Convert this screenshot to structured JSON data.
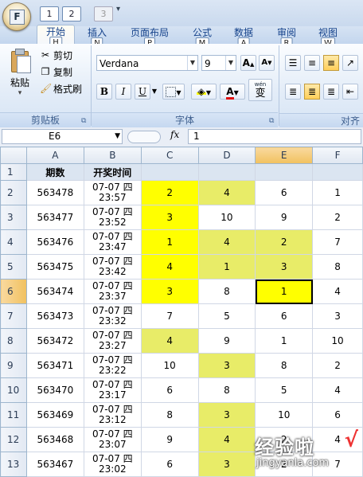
{
  "quick_access": {
    "office_key": "F",
    "keytips": [
      "1",
      "2",
      "3"
    ]
  },
  "tabs": [
    {
      "label": "开始",
      "keytip": "H",
      "active": true
    },
    {
      "label": "插入",
      "keytip": "N",
      "active": false
    },
    {
      "label": "页面布局",
      "keytip": "P",
      "active": false
    },
    {
      "label": "公式",
      "keytip": "M",
      "active": false
    },
    {
      "label": "数据",
      "keytip": "A",
      "active": false
    },
    {
      "label": "审阅",
      "keytip": "R",
      "active": false
    },
    {
      "label": "视图",
      "keytip": "W",
      "active": false
    }
  ],
  "ribbon": {
    "clipboard": {
      "paste_label": "粘贴",
      "cut_label": "剪切",
      "copy_label": "复制",
      "format_painter_label": "格式刷",
      "group_label": "剪贴板"
    },
    "font": {
      "font_name": "Verdana",
      "font_size": "9",
      "grow_label": "A",
      "shrink_label": "A",
      "bold_label": "B",
      "italic_label": "I",
      "underline_label": "U",
      "font_color_label": "A",
      "phonetic_label": "变",
      "phonetic_top": "wén",
      "group_label": "字体"
    },
    "alignment": {
      "group_label": "对齐"
    }
  },
  "formula_bar": {
    "name_box": "E6",
    "fx_label": "fx",
    "value": "1"
  },
  "sheet": {
    "columns": [
      "A",
      "B",
      "C",
      "D",
      "E",
      "F"
    ],
    "row_numbers": [
      "1",
      "2",
      "3",
      "4",
      "5",
      "6",
      "7",
      "8",
      "9",
      "10",
      "11",
      "12",
      "13"
    ],
    "header": {
      "period": "期数",
      "time": "开奖时间"
    },
    "rows": [
      {
        "period": "563478",
        "date": "07-07 四",
        "time": "23:57",
        "c": "2",
        "d": "4",
        "e": "6",
        "f": "1"
      },
      {
        "period": "563477",
        "date": "07-07 四",
        "time": "23:52",
        "c": "3",
        "d": "10",
        "e": "9",
        "f": "2"
      },
      {
        "period": "563476",
        "date": "07-07 四",
        "time": "23:47",
        "c": "1",
        "d": "4",
        "e": "2",
        "f": "7"
      },
      {
        "period": "563475",
        "date": "07-07 四",
        "time": "23:42",
        "c": "4",
        "d": "1",
        "e": "3",
        "f": "8"
      },
      {
        "period": "563474",
        "date": "07-07 四",
        "time": "23:37",
        "c": "3",
        "d": "8",
        "e": "1",
        "f": "4"
      },
      {
        "period": "563473",
        "date": "07-07 四",
        "time": "23:32",
        "c": "7",
        "d": "5",
        "e": "6",
        "f": "3"
      },
      {
        "period": "563472",
        "date": "07-07 四",
        "time": "23:27",
        "c": "4",
        "d": "9",
        "e": "1",
        "f": "10"
      },
      {
        "period": "563471",
        "date": "07-07 四",
        "time": "23:22",
        "c": "10",
        "d": "3",
        "e": "8",
        "f": "2"
      },
      {
        "period": "563470",
        "date": "07-07 四",
        "time": "23:17",
        "c": "6",
        "d": "8",
        "e": "5",
        "f": "4"
      },
      {
        "period": "563469",
        "date": "07-07 四",
        "time": "23:12",
        "c": "8",
        "d": "3",
        "e": "10",
        "f": "6"
      },
      {
        "period": "563468",
        "date": "07-07 四",
        "time": "23:07",
        "c": "9",
        "d": "4",
        "e": "2",
        "f": "4"
      },
      {
        "period": "563467",
        "date": "07-07 四",
        "time": "23:02",
        "c": "6",
        "d": "3",
        "e": "2",
        "f": "7"
      }
    ]
  },
  "colors": {
    "highlight_bright": "#ffff00",
    "highlight_soft": "#e8ec68",
    "selected_header": "#f1c15f"
  },
  "watermark": {
    "title": "经验啦",
    "check": "√",
    "url": "jingyanla.com"
  }
}
